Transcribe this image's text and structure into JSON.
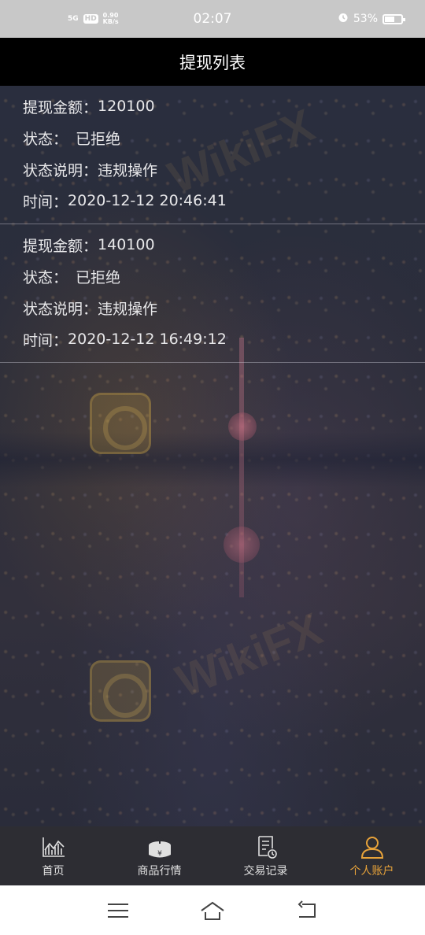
{
  "status_bar": {
    "network": "5G",
    "hd": "HD",
    "speed": "0.90",
    "speed_unit": "KB/s",
    "time": "02:07",
    "battery": "53%"
  },
  "header": {
    "title": "提现列表"
  },
  "records": [
    {
      "amount_label": "提现金额：",
      "amount": "120100",
      "status_label": "状态：",
      "status": "已拒绝",
      "note_label": "状态说明：",
      "note": "违规操作",
      "time_label": "时间：",
      "time": "2020-12-12 20:46:41"
    },
    {
      "amount_label": "提现金额：",
      "amount": "140100",
      "status_label": "状态：",
      "status": "已拒绝",
      "note_label": "状态说明：",
      "note": "违规操作",
      "time_label": "时间：",
      "time": "2020-12-12 16:49:12"
    }
  ],
  "watermark": "WikiFX",
  "bottom_nav": [
    {
      "label": "首页",
      "icon": "chart-icon",
      "active": false
    },
    {
      "label": "商品行情",
      "icon": "yen-box-icon",
      "active": false
    },
    {
      "label": "交易记录",
      "icon": "document-clock-icon",
      "active": false
    },
    {
      "label": "个人账户",
      "icon": "person-icon",
      "active": true
    }
  ],
  "colors": {
    "accent": "#e8a33a",
    "header_bg": "#000000",
    "nav_bg": "#2d2d33",
    "text": "#e8e8ea"
  }
}
